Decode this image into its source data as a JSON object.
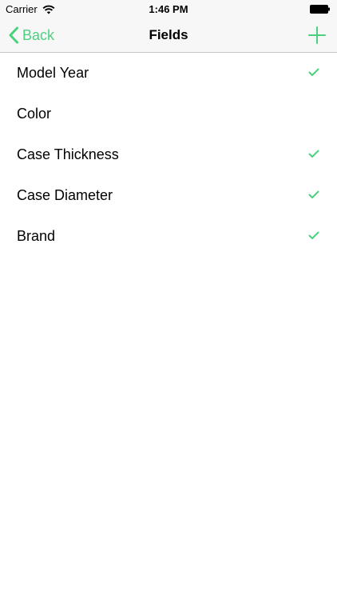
{
  "status": {
    "carrier": "Carrier",
    "time": "1:46 PM"
  },
  "nav": {
    "back_label": "Back",
    "title": "Fields"
  },
  "accent_color": "#4cd080",
  "fields": [
    {
      "label": "Model Year",
      "checked": true
    },
    {
      "label": "Color",
      "checked": false
    },
    {
      "label": "Case Thickness",
      "checked": true
    },
    {
      "label": "Case Diameter",
      "checked": true
    },
    {
      "label": "Brand",
      "checked": true
    }
  ]
}
